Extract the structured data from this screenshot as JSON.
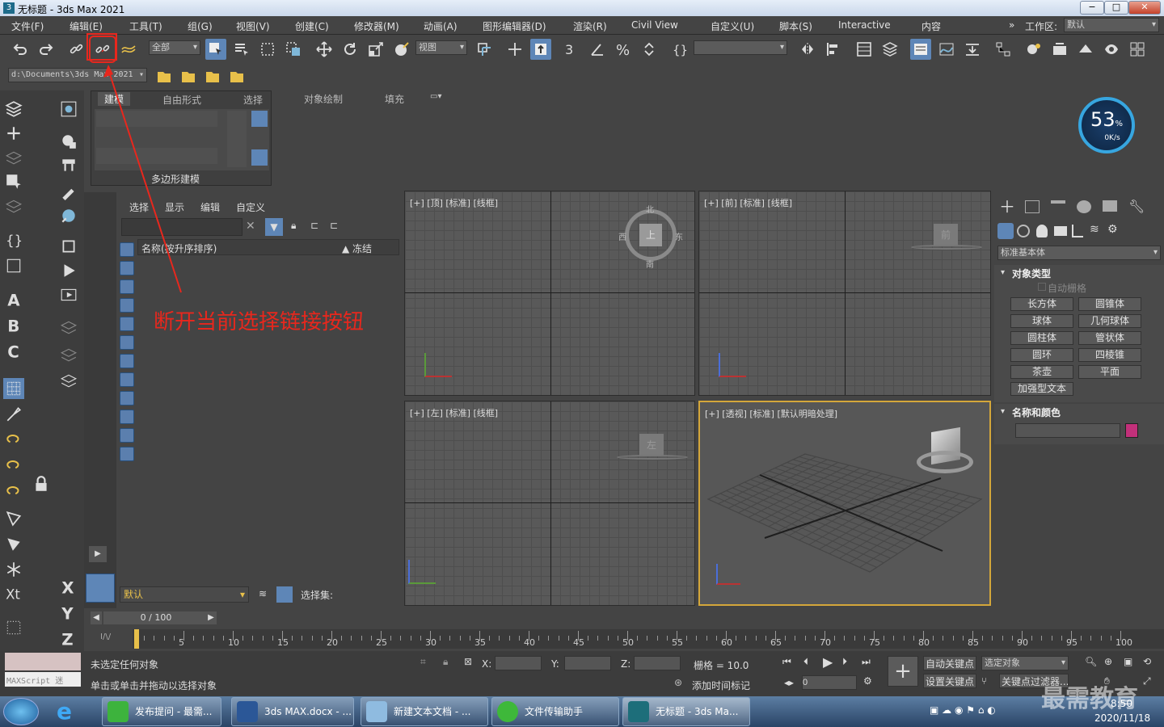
{
  "window": {
    "title": "无标题 - 3ds Max 2021"
  },
  "menu": [
    "文件(F)",
    "编辑(E)",
    "工具(T)",
    "组(G)",
    "视图(V)",
    "创建(C)",
    "修改器(M)",
    "动画(A)",
    "图形编辑器(D)",
    "渲染(R)",
    "Civil View",
    "自定义(U)",
    "脚本(S)",
    "Interactive",
    "内容"
  ],
  "workspace": {
    "label": "工作区:",
    "value": "默认"
  },
  "toolbar": {
    "selection_filter": "全部",
    "ref_coord": "视图",
    "named_sel": ""
  },
  "toolbar2": {
    "path": "d:\\Documents\\3ds Max 2021"
  },
  "ribbon": {
    "tabs": [
      "建模",
      "自由形式",
      "选择",
      "对象绘制",
      "填充"
    ],
    "panel_label": "多边形建模"
  },
  "scene_explorer": {
    "menus": [
      "选择",
      "显示",
      "编辑",
      "自定义"
    ],
    "col_name": "名称(按升序排序)",
    "col_frozen": "▲ 冻结",
    "layer": "默认",
    "selset_label": "选择集:"
  },
  "viewports": [
    {
      "label": "[+] [顶] [标准] [线框]"
    },
    {
      "label": "[+] [前] [标准] [线框]"
    },
    {
      "label": "[+] [左] [标准] [线框]"
    },
    {
      "label": "[+] [透视] [标准] [默认明暗处理]"
    }
  ],
  "viewcube": {
    "top": "上",
    "front": "前",
    "left": "左",
    "n": "北",
    "s": "南",
    "w": "西",
    "e": "东"
  },
  "command_panel": {
    "dropdown": "标准基本体",
    "section_object_type": "对象类型",
    "autogrid": "自动栅格",
    "buttons": [
      "长方体",
      "圆锥体",
      "球体",
      "几何球体",
      "圆柱体",
      "管状体",
      "圆环",
      "四棱锥",
      "茶壶",
      "平面",
      "加强型文本"
    ],
    "section_name_color": "名称和颜色",
    "color": "#c2307a"
  },
  "timeline": {
    "frame": "0 / 100",
    "ticks": [
      "5",
      "10",
      "15",
      "20",
      "25",
      "30",
      "35",
      "40",
      "45",
      "50",
      "55",
      "60",
      "65",
      "70",
      "75",
      "80",
      "85",
      "90",
      "95",
      "100"
    ]
  },
  "status": {
    "line1": "未选定任何对象",
    "line2": "单击或单击并拖动以选择对象",
    "maxscript": "MAXScript 迷",
    "x_label": "X:",
    "y_label": "Y:",
    "z_label": "Z:",
    "grid": "栅格 = 10.0",
    "add_tag": "添加时间标记",
    "autokey": "自动关键点",
    "setkey": "设置关键点",
    "sel_obj": "选定对象",
    "keyfilter": "关键点过滤器...",
    "frame_input": "0"
  },
  "annotation": "断开当前选择链接按钮",
  "speed": {
    "percent": "53",
    "unit": "%",
    "rate": "0K/s"
  },
  "taskbar": {
    "items": [
      "发布提问 - 最需...",
      "3ds MAX.docx - ...",
      "新建文本文档 - ...",
      "文件传输助手",
      "无标题 - 3ds Ma..."
    ],
    "time": "8:50",
    "date": "2020/11/18"
  },
  "watermark": "最需教育"
}
